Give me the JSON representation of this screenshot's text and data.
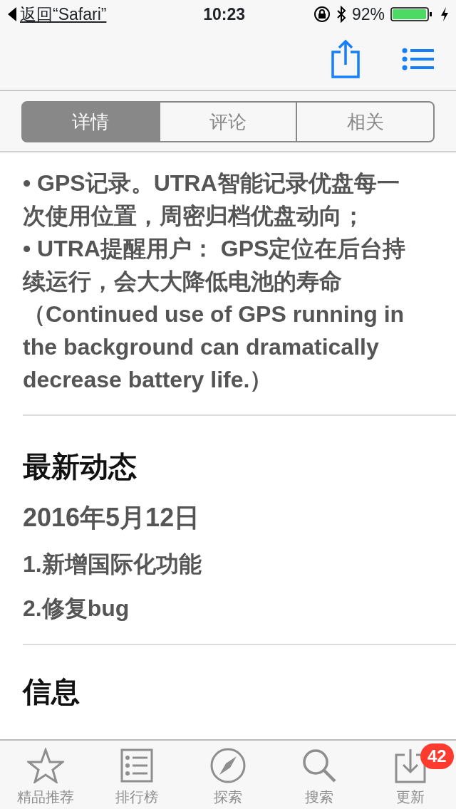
{
  "status_bar": {
    "back_label": "返回“Safari”",
    "time": "10:23",
    "battery": "92%"
  },
  "segments": [
    {
      "label": "详情",
      "selected": true
    },
    {
      "label": "评论",
      "selected": false
    },
    {
      "label": "相关",
      "selected": false
    }
  ],
  "description": [
    "• GPS记录。UTRA智能记录优盘每一次使用位置，周密归档优盘动向；",
    "• UTRA提醒用户： GPS定位在后台持续运行，会大大降低电池的寿命（Continued use of GPS running in the background can dramatically decrease battery life.）"
  ],
  "whats_new": {
    "title": "最新动态",
    "date": "2016年5月12日",
    "items": [
      "1.新增国际化功能",
      "2.修复bug"
    ]
  },
  "info": {
    "title": "信息"
  },
  "tab_bar": [
    {
      "label": "精品推荐",
      "selected": false
    },
    {
      "label": "排行榜",
      "selected": false
    },
    {
      "label": "探索",
      "selected": false
    },
    {
      "label": "搜索",
      "selected": false
    },
    {
      "label": "更新",
      "selected": false,
      "badge": "42"
    }
  ]
}
